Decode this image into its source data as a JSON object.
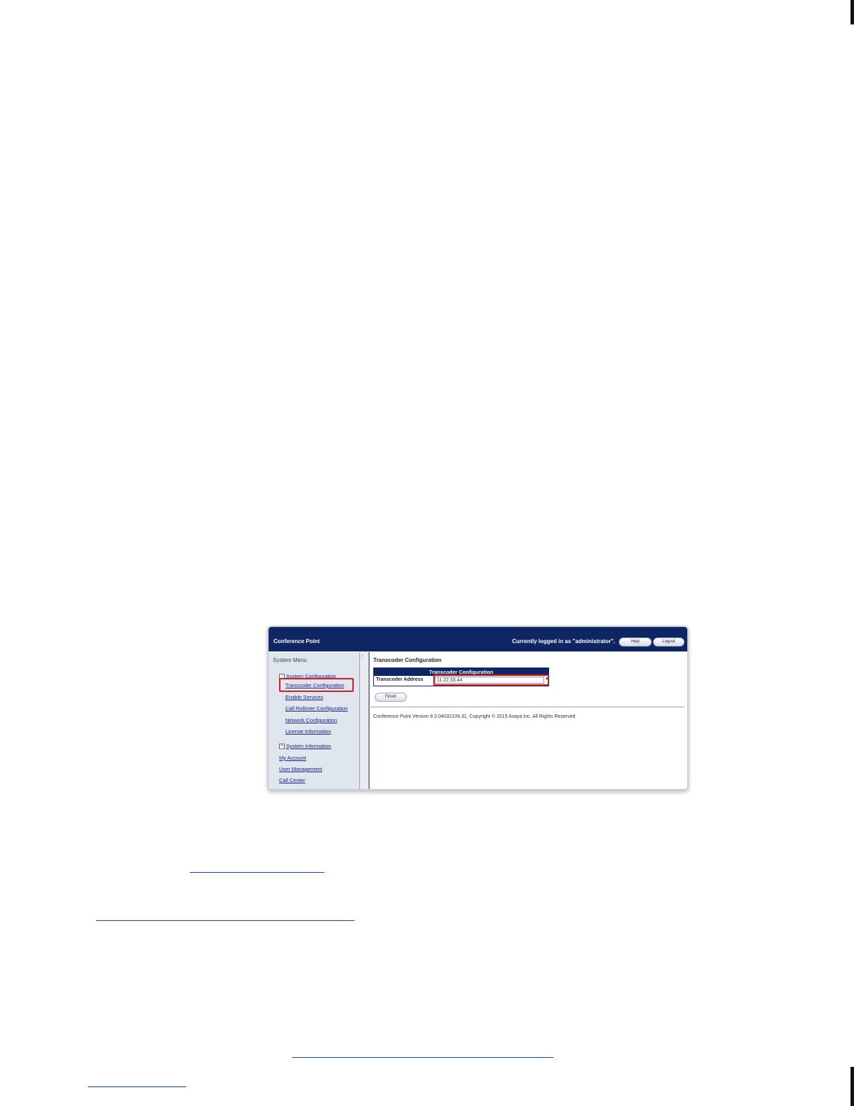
{
  "header": {
    "app_title": "Conference Point",
    "logged_in_text": "Currently logged in as \"administrator\".",
    "help_label": "Help",
    "logout_label": "Logout"
  },
  "sidebar": {
    "title": "System Menu",
    "system_configuration": "System Configuration",
    "items": [
      "Transcoder Configuration",
      "Enable Services",
      "Call Rollover Configuration",
      "Network Configuration",
      "License Information"
    ],
    "system_information": "System Information",
    "top_items": [
      "My Account",
      "User Management",
      "Call Center"
    ]
  },
  "main": {
    "page_title": "Transcoder Configuration",
    "table_header": "Transcoder Configuration",
    "field_label": "Transcoder Address",
    "field_value": "11.22.33.44",
    "finish_label": "Finish",
    "footer": "Conference Point Version 8.3.04032109.31, Copyright © 2015 Avaya Inc. All Rights Reserved"
  },
  "colors": {
    "header": "#0e2764",
    "highlight": "#e01a1a",
    "link": "#1f3fb0"
  },
  "icons": {
    "collapse": "minus-square-icon",
    "expand": "plus-square-icon",
    "dropdown": "chevron-down-icon",
    "scroll_up": "scroll-up-arrow-icon"
  }
}
